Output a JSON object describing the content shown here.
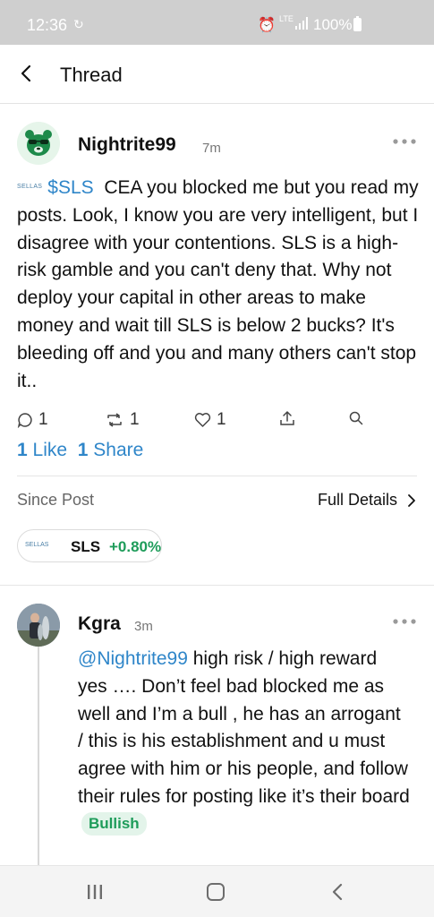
{
  "status_bar": {
    "time": "12:36",
    "sync_icon": "sync-icon",
    "alarm_icon": "alarm-icon",
    "network": "LTE",
    "battery": "100%"
  },
  "header": {
    "back_icon": "chevron-left-icon",
    "title": "Thread"
  },
  "post": {
    "username": "Nightrite99",
    "time": "7m",
    "ticker_logo_text": "SELLAS",
    "cashtag": "$SLS",
    "text": "CEA you blocked me but you read my posts.  Look, I know you are very intelligent, but I disagree with your contentions.  SLS is a high-risk gamble and you can't deny that.  Why not deploy your capital in other areas to make money and wait till SLS is below 2 bucks?  It's bleeding off and you and many others can't stop it..",
    "actions": {
      "comments": "1",
      "reposts": "1",
      "likes": "1"
    },
    "likes_summary": {
      "count": "1",
      "label": "Like"
    },
    "shares_summary": {
      "count": "1",
      "label": "Share"
    },
    "since_post_label": "Since Post",
    "full_details_label": "Full Details",
    "ticker_chip": {
      "logo_text": "SELLAS",
      "symbol": "SLS",
      "change": "+0.80%"
    }
  },
  "reply": {
    "username": "Kgra",
    "time": "3m",
    "mention": "@Nightrite99",
    "text": "high risk / high reward yes …. Don’t feel bad blocked me as well and I’m a bull , he has an arrogant / this is his establishment and u must agree with him or his people, and follow their rules for posting like it’s their board",
    "sentiment": "Bullish"
  },
  "colors": {
    "link": "#2f86c9",
    "positive": "#1e9c5a",
    "status_bar_bg": "#cfcfcf"
  }
}
